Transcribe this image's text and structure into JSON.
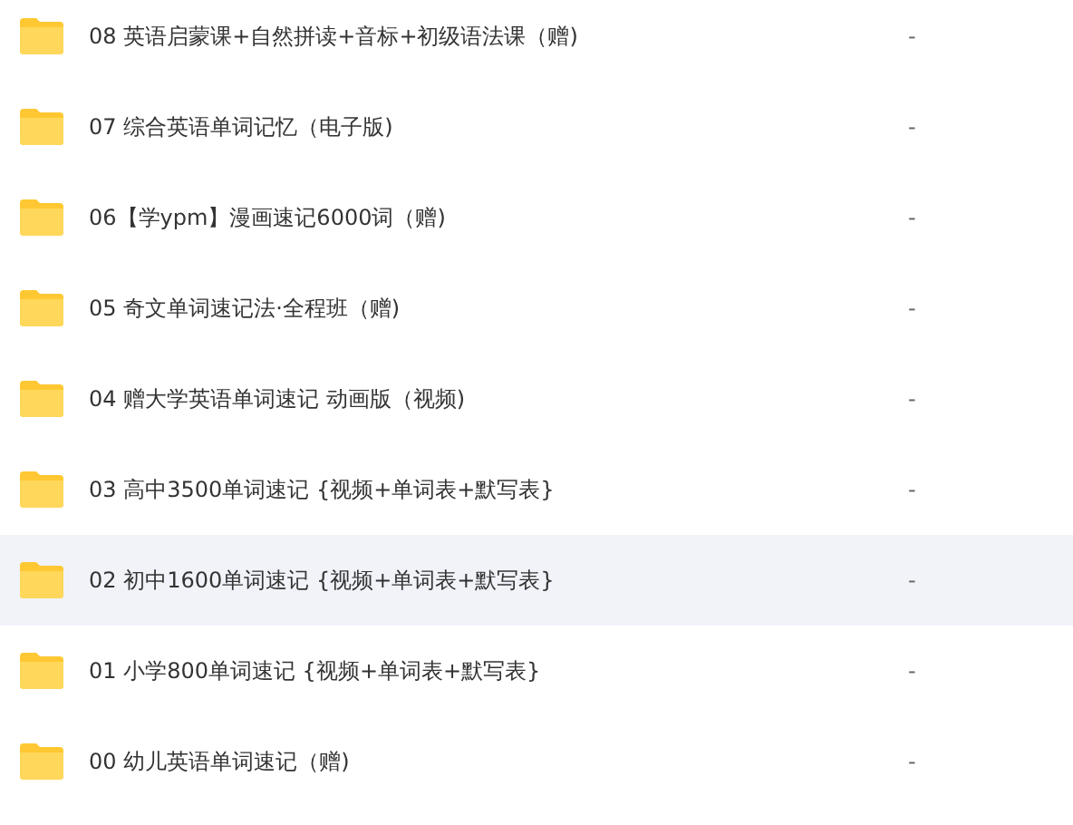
{
  "files": [
    {
      "name": "08 英语启蒙课+自然拼读+音标+初级语法课（赠)",
      "size": "-",
      "selected": false
    },
    {
      "name": "07 综合英语单词记忆（电子版)",
      "size": "-",
      "selected": false
    },
    {
      "name": "06【学ypm】漫画速记6000词（赠)",
      "size": "-",
      "selected": false
    },
    {
      "name": "05 奇文单词速记法·全程班（赠)",
      "size": "-",
      "selected": false
    },
    {
      "name": "04 赠大学英语单词速记 动画版（视频)",
      "size": "-",
      "selected": false
    },
    {
      "name": "03 高中3500单词速记 {视频+单词表+默写表}",
      "size": "-",
      "selected": false
    },
    {
      "name": "02 初中1600单词速记 {视频+单词表+默写表}",
      "size": "-",
      "selected": true
    },
    {
      "name": "01 小学800单词速记 {视频+单词表+默写表}",
      "size": "-",
      "selected": false
    },
    {
      "name": "00 幼儿英语单词速记（赠)",
      "size": "-",
      "selected": false
    }
  ]
}
